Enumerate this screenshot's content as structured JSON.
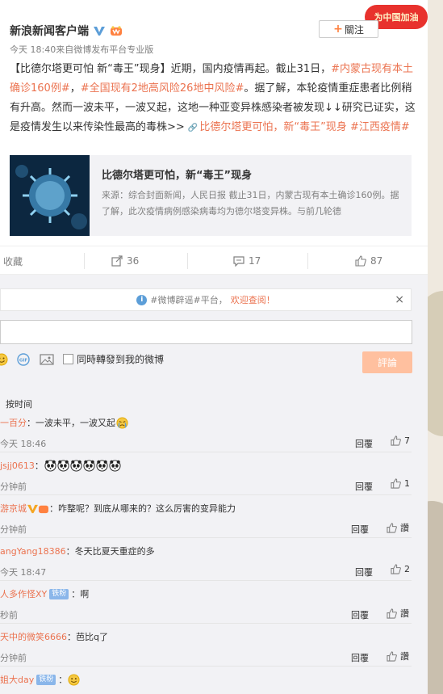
{
  "app": {
    "promo_label": "为中国加油"
  },
  "post": {
    "author": "新浪新闻客户端",
    "meta": "今天 18:40来自微博发布平台专业版",
    "follow_label": "關注",
    "body_segments": [
      {
        "text": "【比德尔塔更可怕 新“毒王”现身】近期，国内疫情再起。截止31日，",
        "tag": false
      },
      {
        "text": "#内蒙古现有本土确诊160例#",
        "tag": true
      },
      {
        "text": "，",
        "tag": false
      },
      {
        "text": "#全国现有2地高风险26地中风险#",
        "tag": true
      },
      {
        "text": "。据了解，本轮疫情重症患者比例稍有升高。然而一波未平，一波又起，这地一种亚变异株感染者被发现↓↓研究已证实，这是疫情发生以来传染性最高的毒株>> ",
        "tag": false
      },
      {
        "text": "比德尔塔更可怕，新“毒王”现身",
        "tag": true,
        "link": true
      },
      {
        "text": " ",
        "tag": false
      },
      {
        "text": "#江西疫情#",
        "tag": true
      }
    ],
    "link_card": {
      "title": "比德尔塔更可怕，新“毒王”现身",
      "desc": "来源：综合封面新闻，人民日报 截止31日，内蒙古现有本土确诊160例。据了解，此次疫情病例感染病毒均为德尔塔变异株。与前几轮德"
    },
    "actions": {
      "favorite": "收藏",
      "repost": "36",
      "comment": "17",
      "like": "87"
    }
  },
  "comment_box": {
    "notice_prefix": "#微博辟谣#平台，",
    "notice_link": "欢迎查阅！",
    "repost_label": "同時轉發到我的微博",
    "submit_label": "評論",
    "sort_label": "按时间"
  },
  "comments": [
    {
      "user": "一百分",
      "text": "：一波未平，一波又起",
      "time": "今天 18:46",
      "reply": "回覆",
      "likes": "7",
      "emoji": [
        "crying"
      ],
      "badge": ""
    },
    {
      "user": "jsjj0613",
      "text": "：",
      "time": "分钟前",
      "reply": "回覆",
      "likes": "1",
      "emoji": [
        "panda",
        "panda",
        "panda",
        "panda",
        "panda",
        "panda"
      ],
      "badge": ""
    },
    {
      "user": "游京城",
      "text": "：咋整呢？到底从哪来的？这么厉害的变异能力",
      "time": "分钟前",
      "reply": "回覆",
      "likes": "讚",
      "emoji": [],
      "badge": "vip"
    },
    {
      "user": "angYang18386",
      "text": "：冬天比夏天重症的多",
      "time": "今天 18:47",
      "reply": "回覆",
      "likes": "2",
      "emoji": [],
      "badge": ""
    },
    {
      "user": "人多作怪XY",
      "text": "：啊",
      "time": "秒前",
      "reply": "回覆",
      "likes": "讚",
      "emoji": [],
      "badge": "铁粉"
    },
    {
      "user": "天中的微笑6666",
      "text": "：芭比q了",
      "time": "分钟前",
      "reply": "回覆",
      "likes": "讚",
      "emoji": [],
      "badge": ""
    },
    {
      "user": "姐大day",
      "text": "：",
      "time": "",
      "reply": "",
      "likes": "",
      "emoji": [
        "smile"
      ],
      "badge": "铁粉"
    }
  ],
  "colors": {
    "accent": "#eb7350",
    "link_blue": "#5c9ed8",
    "submit_bg": "#ffc09f"
  }
}
